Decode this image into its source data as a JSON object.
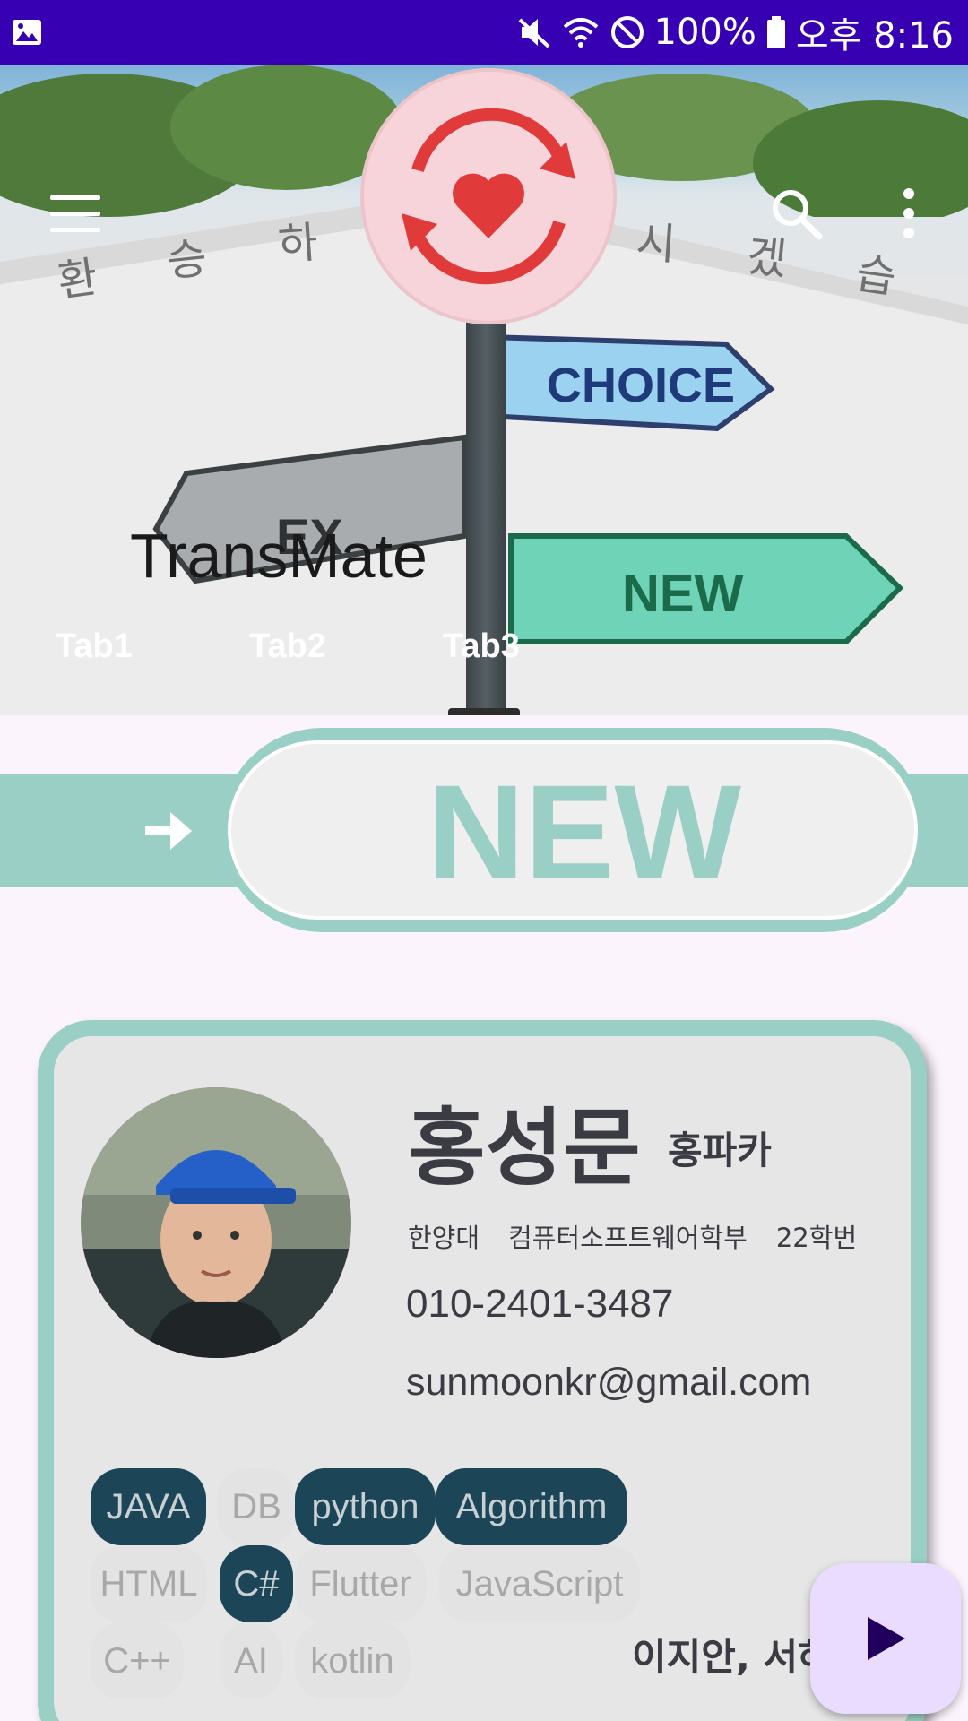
{
  "status_bar": {
    "battery": "100%",
    "time": "오후 8:16",
    "icons": [
      "image-icon",
      "mute-icon",
      "wifi-icon",
      "do-not-disturb-icon",
      "battery-icon"
    ]
  },
  "header": {
    "title": "TransMate",
    "background_texts": [
      "환",
      "승",
      "하",
      "시",
      "겠",
      "습"
    ],
    "sign_labels": {
      "choice": "CHOICE",
      "ex": "EX",
      "new": "NEW"
    },
    "icons": [
      "menu-icon",
      "search-icon",
      "more-vert-icon"
    ]
  },
  "tabs": [
    {
      "label": "Tab1"
    },
    {
      "label": "Tab2"
    },
    {
      "label": "Tab3",
      "selected": true
    }
  ],
  "banner": {
    "label": "NEW"
  },
  "profile": {
    "name": "홍성문",
    "nickname": "홍파카",
    "school": "한양대",
    "department": "컴퓨터소프트웨어학부",
    "student_id": "22학번",
    "phone": "010-2401-3487",
    "email": "sunmoonkr@gmail.com",
    "skills": [
      {
        "label": "JAVA",
        "selected": true
      },
      {
        "label": "DB",
        "selected": false
      },
      {
        "label": "python",
        "selected": true
      },
      {
        "label": "Algorithm",
        "selected": true
      },
      {
        "label": "HTML",
        "selected": false
      },
      {
        "label": "C#",
        "selected": true
      },
      {
        "label": "Flutter",
        "selected": false
      },
      {
        "label": "JavaScript",
        "selected": false
      },
      {
        "label": "C++",
        "selected": false
      },
      {
        "label": "AI",
        "selected": false
      },
      {
        "label": "kotlin",
        "selected": false
      }
    ],
    "members": "이지안, 서하"
  },
  "colors": {
    "status_bar": "#3700b3",
    "card_border": "#99cfc4",
    "chip_selected": "#1c4658",
    "fab": "#eadcff",
    "fab_icon": "#21005d"
  }
}
